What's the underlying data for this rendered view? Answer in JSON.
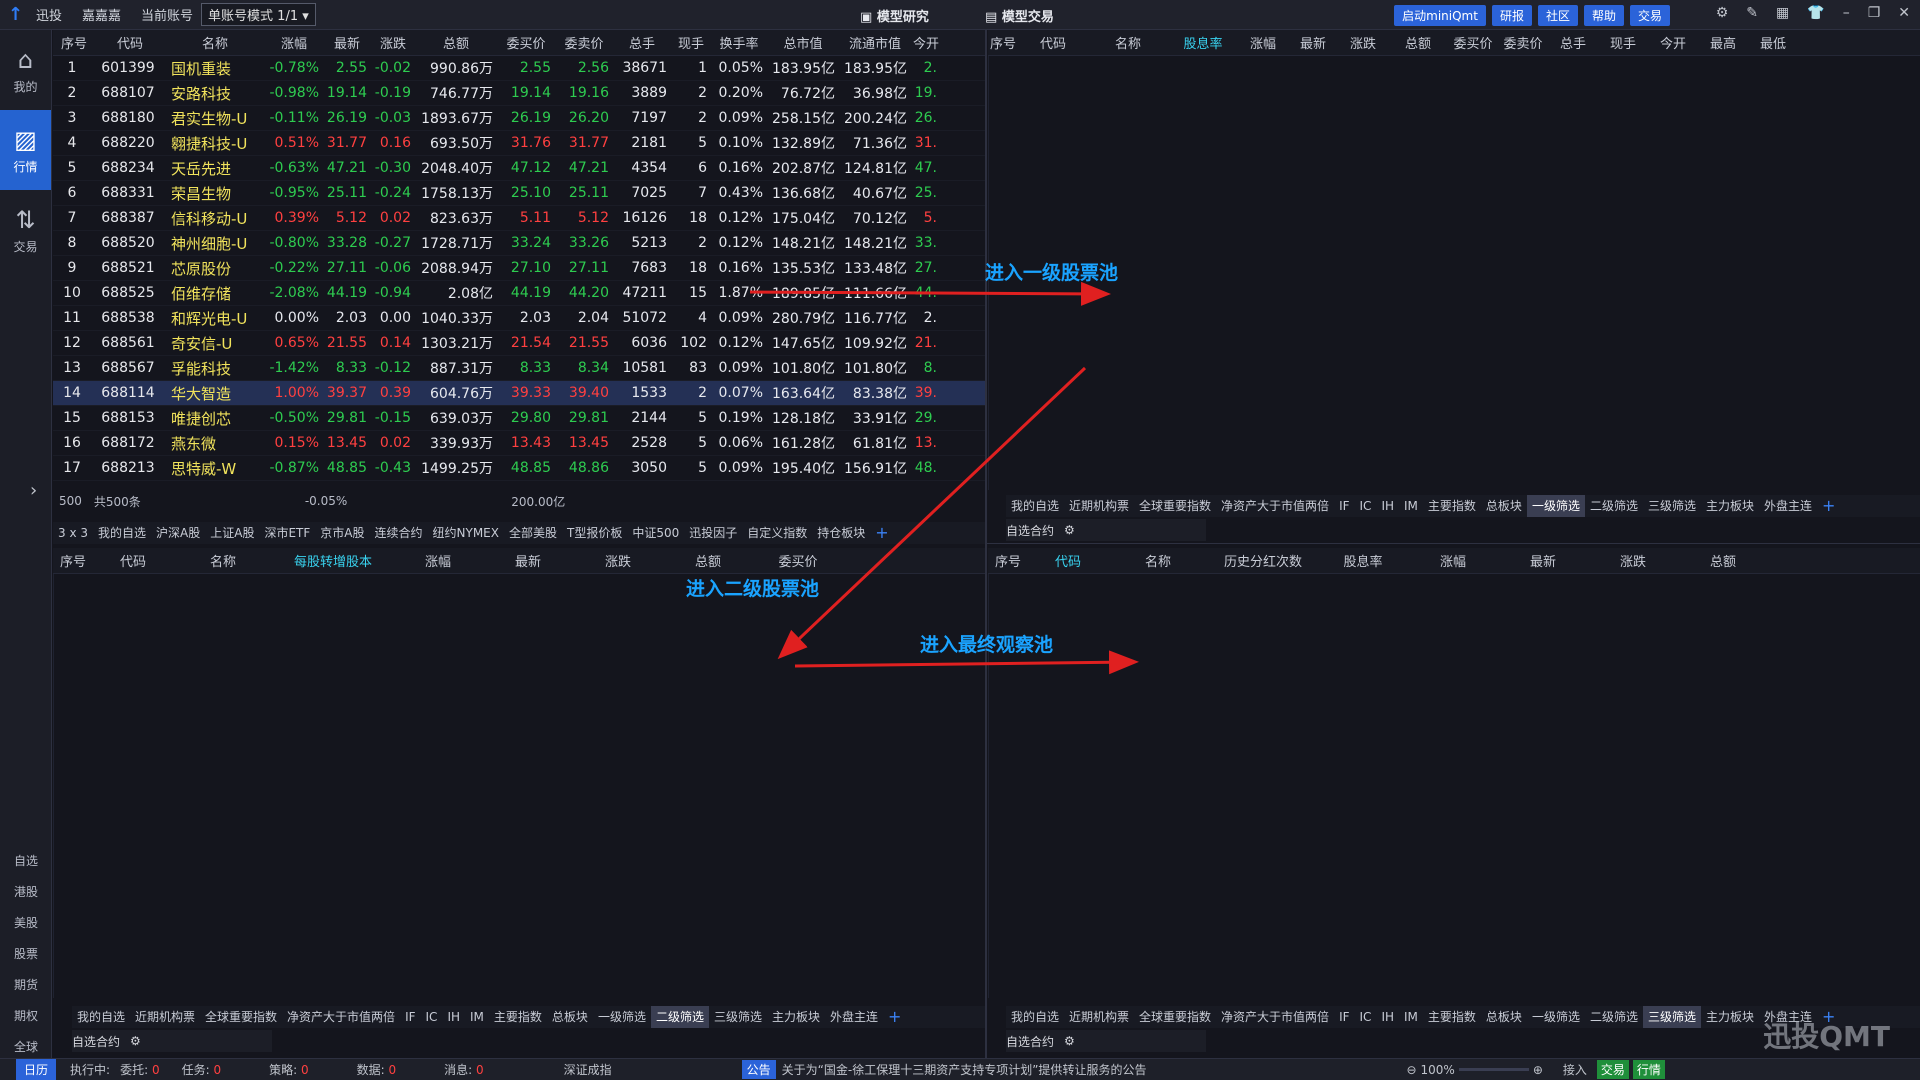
{
  "topbar": {
    "app": "迅投",
    "account": "嘉嘉嘉",
    "current_account_label": "当前账号",
    "mode": "单账号模式 1/1",
    "model_research": "模型研究",
    "model_trade": "模型交易",
    "buttons": [
      "启动miniQmt",
      "研报",
      "社区",
      "帮助",
      "交易"
    ]
  },
  "sidebar": {
    "items": [
      {
        "icon": "home-icon",
        "label": "我的"
      },
      {
        "icon": "chart-icon",
        "label": "行情"
      },
      {
        "icon": "trade-icon",
        "label": "交易"
      }
    ],
    "small": [
      "自选",
      "港股",
      "美股",
      "股票",
      "期货",
      "期权",
      "全球"
    ]
  },
  "top_left": {
    "headers": [
      "序号",
      "代码",
      "名称",
      "涨幅",
      "最新",
      "涨跌",
      "总额",
      "委买价",
      "委卖价",
      "总手",
      "现手",
      "换手率",
      "总市值",
      "流通市值",
      "今开"
    ],
    "rows": [
      [
        "1",
        "601399",
        "国机重装",
        "-0.78%",
        "2.55",
        "-0.02",
        "990.86万",
        "2.55",
        "2.56",
        "38671",
        "1",
        "0.05%",
        "183.95亿",
        "183.95亿",
        "2."
      ],
      [
        "2",
        "688107",
        "安路科技",
        "-0.98%",
        "19.14",
        "-0.19",
        "746.77万",
        "19.14",
        "19.16",
        "3889",
        "2",
        "0.20%",
        "76.72亿",
        "36.98亿",
        "19."
      ],
      [
        "3",
        "688180",
        "君实生物-U",
        "-0.11%",
        "26.19",
        "-0.03",
        "1893.67万",
        "26.19",
        "26.20",
        "7197",
        "2",
        "0.09%",
        "258.15亿",
        "200.24亿",
        "26."
      ],
      [
        "4",
        "688220",
        "翱捷科技-U",
        "0.51%",
        "31.77",
        "0.16",
        "693.50万",
        "31.76",
        "31.77",
        "2181",
        "5",
        "0.10%",
        "132.89亿",
        "71.36亿",
        "31."
      ],
      [
        "5",
        "688234",
        "天岳先进",
        "-0.63%",
        "47.21",
        "-0.30",
        "2048.40万",
        "47.12",
        "47.21",
        "4354",
        "6",
        "0.16%",
        "202.87亿",
        "124.81亿",
        "47."
      ],
      [
        "6",
        "688331",
        "荣昌生物",
        "-0.95%",
        "25.11",
        "-0.24",
        "1758.13万",
        "25.10",
        "25.11",
        "7025",
        "7",
        "0.43%",
        "136.68亿",
        "40.67亿",
        "25."
      ],
      [
        "7",
        "688387",
        "信科移动-U",
        "0.39%",
        "5.12",
        "0.02",
        "823.63万",
        "5.11",
        "5.12",
        "16126",
        "18",
        "0.12%",
        "175.04亿",
        "70.12亿",
        "5."
      ],
      [
        "8",
        "688520",
        "神州细胞-U",
        "-0.80%",
        "33.28",
        "-0.27",
        "1728.71万",
        "33.24",
        "33.26",
        "5213",
        "2",
        "0.12%",
        "148.21亿",
        "148.21亿",
        "33."
      ],
      [
        "9",
        "688521",
        "芯原股份",
        "-0.22%",
        "27.11",
        "-0.06",
        "2088.94万",
        "27.10",
        "27.11",
        "7683",
        "18",
        "0.16%",
        "135.53亿",
        "133.48亿",
        "27."
      ],
      [
        "10",
        "688525",
        "佰维存储",
        "-2.08%",
        "44.19",
        "-0.94",
        "2.08亿",
        "44.19",
        "44.20",
        "47211",
        "15",
        "1.87%",
        "189.85亿",
        "111.66亿",
        "44."
      ],
      [
        "11",
        "688538",
        "和辉光电-U",
        "0.00%",
        "2.03",
        "0.00",
        "1040.33万",
        "2.03",
        "2.04",
        "51072",
        "4",
        "0.09%",
        "280.79亿",
        "116.77亿",
        "2."
      ],
      [
        "12",
        "688561",
        "奇安信-U",
        "0.65%",
        "21.55",
        "0.14",
        "1303.21万",
        "21.54",
        "21.55",
        "6036",
        "102",
        "0.12%",
        "147.65亿",
        "109.92亿",
        "21."
      ],
      [
        "13",
        "688567",
        "孚能科技",
        "-1.42%",
        "8.33",
        "-0.12",
        "887.31万",
        "8.33",
        "8.34",
        "10581",
        "83",
        "0.09%",
        "101.80亿",
        "101.80亿",
        "8."
      ],
      [
        "14",
        "688114",
        "华大智造",
        "1.00%",
        "39.37",
        "0.39",
        "604.76万",
        "39.33",
        "39.40",
        "1533",
        "2",
        "0.07%",
        "163.64亿",
        "83.38亿",
        "39."
      ],
      [
        "15",
        "688153",
        "唯捷创芯",
        "-0.50%",
        "29.81",
        "-0.15",
        "639.03万",
        "29.80",
        "29.81",
        "2144",
        "5",
        "0.19%",
        "128.18亿",
        "33.91亿",
        "29."
      ],
      [
        "16",
        "688172",
        "燕东微",
        "0.15%",
        "13.45",
        "0.02",
        "339.93万",
        "13.43",
        "13.45",
        "2528",
        "5",
        "0.06%",
        "161.28亿",
        "61.81亿",
        "13."
      ],
      [
        "17",
        "688213",
        "思特威-W",
        "-0.87%",
        "48.85",
        "-0.43",
        "1499.25万",
        "48.85",
        "48.86",
        "3050",
        "5",
        "0.09%",
        "195.40亿",
        "156.91亿",
        "48."
      ]
    ],
    "footer": {
      "count": "500",
      "total": "共500条",
      "avg": "-0.05%",
      "sum": "200.00亿"
    },
    "tabs": [
      "3 x 3",
      "我的自选",
      "沪深A股",
      "上证A股",
      "深市ETF",
      "京市A股",
      "连续合约",
      "纽约NYMEX",
      "全部美股",
      "T型报价板",
      "中证500",
      "迅投因子",
      "自定义指数",
      "持仓板块"
    ]
  },
  "top_right": {
    "headers": [
      "序号",
      "代码",
      "名称",
      "股息率",
      "涨幅",
      "最新",
      "涨跌",
      "总额",
      "委买价",
      "委卖价",
      "总手",
      "现手",
      "今开",
      "最高",
      "最低"
    ],
    "tabs": [
      "我的自选",
      "近期机构票",
      "全球重要指数",
      "净资产大于市值两倍",
      "IF",
      "IC",
      "IH",
      "IM",
      "主要指数",
      "总板块",
      "一级筛选",
      "二级筛选",
      "三级筛选",
      "主力板块",
      "外盘主连"
    ],
    "sub": "自选合约"
  },
  "bottom_left": {
    "headers": [
      "序号",
      "代码",
      "名称",
      "每股转增股本",
      "涨幅",
      "最新",
      "涨跌",
      "总额",
      "委买价"
    ],
    "tabs": [
      "我的自选",
      "近期机构票",
      "全球重要指数",
      "净资产大于市值两倍",
      "IF",
      "IC",
      "IH",
      "IM",
      "主要指数",
      "总板块",
      "一级筛选",
      "二级筛选",
      "三级筛选",
      "主力板块",
      "外盘主连"
    ],
    "sub": "自选合约"
  },
  "bottom_right": {
    "headers": [
      "序号",
      "代码",
      "名称",
      "历史分红次数",
      "股息率",
      "涨幅",
      "最新",
      "涨跌",
      "总额"
    ],
    "tabs": [
      "我的自选",
      "近期机构票",
      "全球重要指数",
      "净资产大于市值两倍",
      "IF",
      "IC",
      "IH",
      "IM",
      "主要指数",
      "总板块",
      "一级筛选",
      "二级筛选",
      "三级筛选",
      "主力板块",
      "外盘主连"
    ],
    "sub": "自选合约"
  },
  "annotations": {
    "a1": "进入一级股票池",
    "a2": "进入二级股票池",
    "a3": "进入最终观察池"
  },
  "statusbar": {
    "calendar": "日历",
    "exec": "执行中:",
    "entrust": "委托:",
    "entrust_n": "0",
    "task": "任务:",
    "task_n": "0",
    "strategy": "策略:",
    "strategy_n": "0",
    "data": "数据:",
    "data_n": "0",
    "msg": "消息:",
    "msg_n": "0",
    "index": "深证成指",
    "notice_tag": "公告",
    "notice": "关于为“国金-徐工保理十三期资产支持专项计划”提供转让服务的公告",
    "zoom": "100%",
    "connect": "接入",
    "trade": "交易",
    "quote": "行情"
  },
  "watermark": "迅投QMT",
  "colors": {
    "up": "#ff4040",
    "down": "#2ecc50",
    "accent": "#2b63d9",
    "name": "#f1e35c",
    "annotation": "#1aa3ff",
    "arrow": "#e02020"
  }
}
